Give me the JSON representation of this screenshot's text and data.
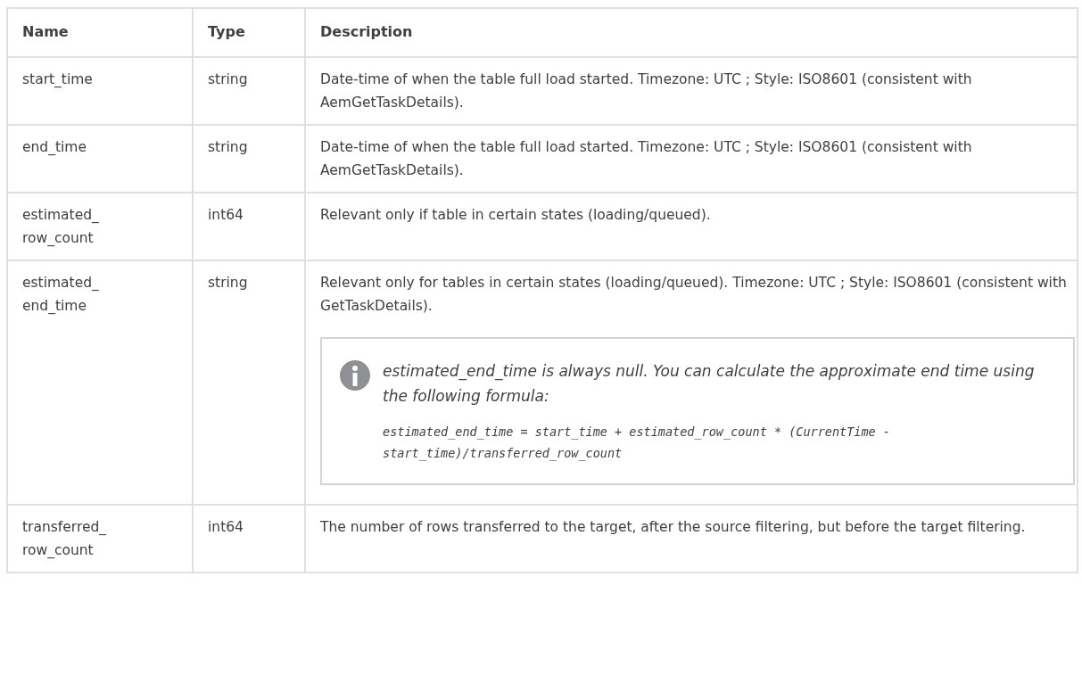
{
  "table": {
    "columns": [
      "Name",
      "Type",
      "Description"
    ],
    "rows": [
      {
        "name": "start_time",
        "type": "string",
        "description": "Date-time of when the table full load started. Timezone: UTC ; Style: ISO8601 (consistent with AemGetTaskDetails)."
      },
      {
        "name": "end_time",
        "type": "string",
        "description": "Date-time of when the table full load started. Timezone: UTC ; Style: ISO8601 (consistent with AemGetTaskDetails)."
      },
      {
        "name": "estimated_row_count",
        "type": "int64",
        "description": "Relevant only if table in certain states (loading/queued)."
      },
      {
        "name": "estimated_end_time",
        "type": "string",
        "description": "Relevant only for tables in certain states (loading/queued). Timezone: UTC ; Style: ISO8601 (consistent with GetTaskDetails).",
        "note": {
          "text": "estimated_end_time is always null. You can calculate the approximate end time using the following formula:",
          "formula": "estimated_end_time = start_time + estimated_row_count * (CurrentTime - start_time)/transferred_row_count"
        }
      },
      {
        "name": "transferred_row_count",
        "type": "int64",
        "description": "The number of rows transferred to the target, after the source filtering, but before the target filtering."
      }
    ]
  }
}
